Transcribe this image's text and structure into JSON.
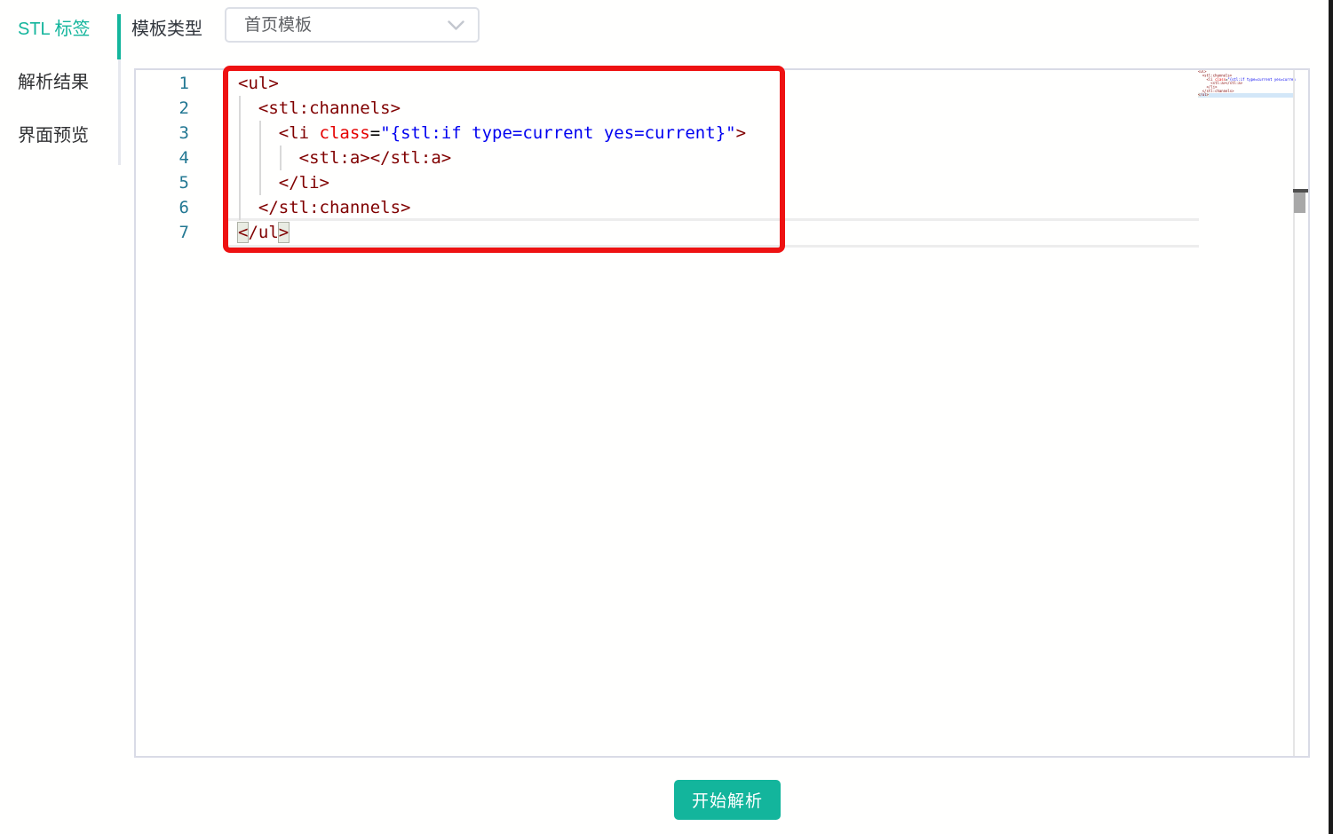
{
  "colors": {
    "accent_teal": "#13b59c",
    "tag_maroon": "#800000",
    "attribute_red": "#e50000",
    "value_blue": "#0000f0",
    "punctuation_black": "#000000",
    "line_number_teal": "#237893",
    "annotation_red": "#ee1212"
  },
  "sidebar": {
    "tabs": [
      {
        "label": "STL 标签",
        "active": true
      },
      {
        "label": "解析结果",
        "active": false
      },
      {
        "label": "界面预览",
        "active": false
      }
    ]
  },
  "toolbar": {
    "template_type_label": "模板类型",
    "template_select_value": "首页模板",
    "chevron_icon": "chevron-down-icon"
  },
  "editor": {
    "current_line": 7,
    "lines": [
      {
        "num": "1",
        "tokens": [
          [
            "tag",
            "<ul>"
          ]
        ]
      },
      {
        "num": "2",
        "tokens": [
          [
            "plain",
            "  "
          ],
          [
            "tag",
            "<stl:channels>"
          ]
        ]
      },
      {
        "num": "3",
        "tokens": [
          [
            "plain",
            "    "
          ],
          [
            "tag",
            "<li"
          ],
          [
            "plain",
            " "
          ],
          [
            "attr",
            "class"
          ],
          [
            "punct",
            "="
          ],
          [
            "value",
            "\"{stl:if type=current yes=current}\""
          ],
          [
            "tag",
            ">"
          ]
        ]
      },
      {
        "num": "4",
        "tokens": [
          [
            "plain",
            "      "
          ],
          [
            "tag",
            "<stl:a></stl:a>"
          ]
        ]
      },
      {
        "num": "5",
        "tokens": [
          [
            "plain",
            "    "
          ],
          [
            "tag",
            "</li>"
          ]
        ]
      },
      {
        "num": "6",
        "tokens": [
          [
            "plain",
            "  "
          ],
          [
            "tag",
            "</stl:channels>"
          ]
        ]
      },
      {
        "num": "7",
        "tokens": [
          [
            "tag-bm",
            "<"
          ],
          [
            "tag",
            "/ul"
          ],
          [
            "tag-bm",
            ">"
          ]
        ]
      }
    ]
  },
  "footer": {
    "parse_button_label": "开始解析"
  }
}
